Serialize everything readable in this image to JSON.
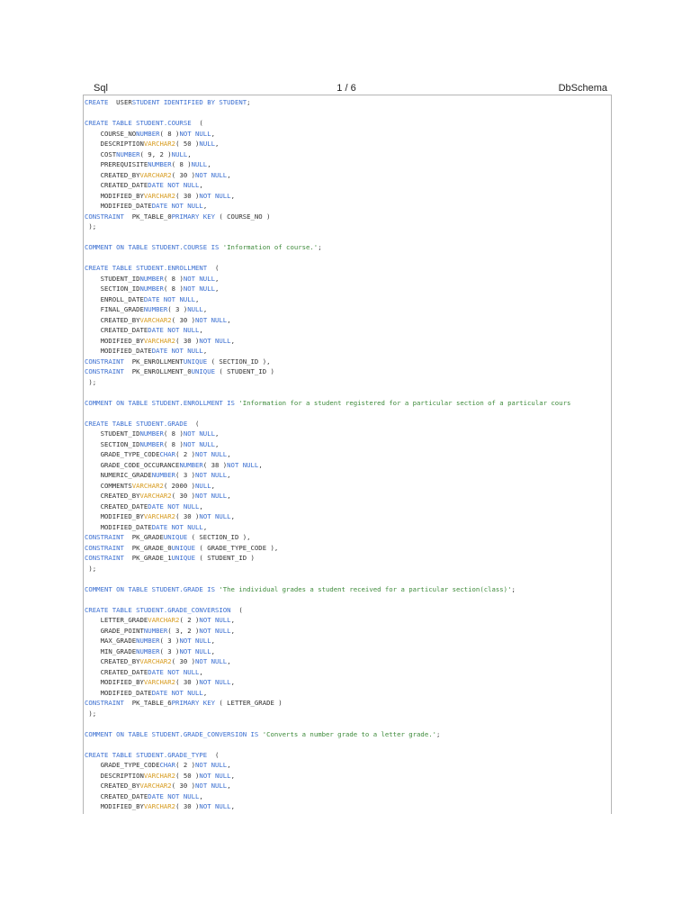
{
  "header": {
    "left": "Sql",
    "center": "1 / 6",
    "right": "DbSchema"
  },
  "colors": {
    "keyword": "#3b6fd1",
    "type": "#d79b1e",
    "string": "#3d8a3a",
    "plain": "#333333",
    "border": "#b5b5b5"
  },
  "code_lines": [
    [
      [
        "k",
        "CREATE  "
      ],
      [
        "p",
        "USER"
      ],
      [
        "k",
        "STUDENT IDENTIFIED BY STUDENT"
      ],
      [
        "p",
        ";"
      ]
    ],
    [],
    [
      [
        "k",
        "CREATE TABLE STUDENT.COURSE  "
      ],
      [
        "p",
        "("
      ]
    ],
    [
      [
        "p",
        "    COURSE_NO"
      ],
      [
        "k",
        "NUMBER"
      ],
      [
        "p",
        "( 8 )"
      ],
      [
        "k",
        "NOT NULL"
      ],
      [
        "p",
        ","
      ]
    ],
    [
      [
        "p",
        "    DESCRIPTION"
      ],
      [
        "t",
        "VARCHAR2"
      ],
      [
        "p",
        "( 50 )"
      ],
      [
        "k",
        "NULL"
      ],
      [
        "p",
        ","
      ]
    ],
    [
      [
        "p",
        "    COST"
      ],
      [
        "k",
        "NUMBER"
      ],
      [
        "p",
        "( 9, 2 )"
      ],
      [
        "k",
        "NULL"
      ],
      [
        "p",
        ","
      ]
    ],
    [
      [
        "p",
        "    PREREQUISITE"
      ],
      [
        "k",
        "NUMBER"
      ],
      [
        "p",
        "( 8 )"
      ],
      [
        "k",
        "NULL"
      ],
      [
        "p",
        ","
      ]
    ],
    [
      [
        "p",
        "    CREATED_BY"
      ],
      [
        "t",
        "VARCHAR2"
      ],
      [
        "p",
        "( 30 )"
      ],
      [
        "k",
        "NOT NULL"
      ],
      [
        "p",
        ","
      ]
    ],
    [
      [
        "p",
        "    CREATED_DATE"
      ],
      [
        "k",
        "DATE NOT NULL"
      ],
      [
        "p",
        ","
      ]
    ],
    [
      [
        "p",
        "    MODIFIED_BY"
      ],
      [
        "t",
        "VARCHAR2"
      ],
      [
        "p",
        "( 30 )"
      ],
      [
        "k",
        "NOT NULL"
      ],
      [
        "p",
        ","
      ]
    ],
    [
      [
        "p",
        "    MODIFIED_DATE"
      ],
      [
        "k",
        "DATE NOT NULL"
      ],
      [
        "p",
        ","
      ]
    ],
    [
      [
        "k",
        "CONSTRAINT  "
      ],
      [
        "p",
        "PK_TABLE_0"
      ],
      [
        "k",
        "PRIMARY KEY"
      ],
      [
        "p",
        " ( COURSE_NO )"
      ]
    ],
    [
      [
        "p",
        " );"
      ]
    ],
    [],
    [
      [
        "k",
        "COMMENT ON TABLE STUDENT.COURSE IS "
      ],
      [
        "s",
        "'Information of course.'"
      ],
      [
        "p",
        ";"
      ]
    ],
    [],
    [
      [
        "k",
        "CREATE TABLE STUDENT.ENROLLMENT  "
      ],
      [
        "p",
        "("
      ]
    ],
    [
      [
        "p",
        "    STUDENT_ID"
      ],
      [
        "k",
        "NUMBER"
      ],
      [
        "p",
        "( 8 )"
      ],
      [
        "k",
        "NOT NULL"
      ],
      [
        "p",
        ","
      ]
    ],
    [
      [
        "p",
        "    SECTION_ID"
      ],
      [
        "k",
        "NUMBER"
      ],
      [
        "p",
        "( 8 )"
      ],
      [
        "k",
        "NOT NULL"
      ],
      [
        "p",
        ","
      ]
    ],
    [
      [
        "p",
        "    ENROLL_DATE"
      ],
      [
        "k",
        "DATE NOT NULL"
      ],
      [
        "p",
        ","
      ]
    ],
    [
      [
        "p",
        "    FINAL_GRADE"
      ],
      [
        "k",
        "NUMBER"
      ],
      [
        "p",
        "( 3 )"
      ],
      [
        "k",
        "NULL"
      ],
      [
        "p",
        ","
      ]
    ],
    [
      [
        "p",
        "    CREATED_BY"
      ],
      [
        "t",
        "VARCHAR2"
      ],
      [
        "p",
        "( 30 )"
      ],
      [
        "k",
        "NOT NULL"
      ],
      [
        "p",
        ","
      ]
    ],
    [
      [
        "p",
        "    CREATED_DATE"
      ],
      [
        "k",
        "DATE NOT NULL"
      ],
      [
        "p",
        ","
      ]
    ],
    [
      [
        "p",
        "    MODIFIED_BY"
      ],
      [
        "t",
        "VARCHAR2"
      ],
      [
        "p",
        "( 30 )"
      ],
      [
        "k",
        "NOT NULL"
      ],
      [
        "p",
        ","
      ]
    ],
    [
      [
        "p",
        "    MODIFIED_DATE"
      ],
      [
        "k",
        "DATE NOT NULL"
      ],
      [
        "p",
        ","
      ]
    ],
    [
      [
        "k",
        "CONSTRAINT  "
      ],
      [
        "p",
        "PK_ENROLLMENT"
      ],
      [
        "k",
        "UNIQUE"
      ],
      [
        "p",
        " ( SECTION_ID ),"
      ]
    ],
    [
      [
        "k",
        "CONSTRAINT  "
      ],
      [
        "p",
        "PK_ENROLLMENT_0"
      ],
      [
        "k",
        "UNIQUE"
      ],
      [
        "p",
        " ( STUDENT_ID )"
      ]
    ],
    [
      [
        "p",
        " );"
      ]
    ],
    [],
    [
      [
        "k",
        "COMMENT ON TABLE STUDENT.ENROLLMENT IS "
      ],
      [
        "s",
        "'Information for a student registered for a particular section of a particular cours"
      ]
    ],
    [],
    [
      [
        "k",
        "CREATE TABLE STUDENT.GRADE  "
      ],
      [
        "p",
        "("
      ]
    ],
    [
      [
        "p",
        "    STUDENT_ID"
      ],
      [
        "k",
        "NUMBER"
      ],
      [
        "p",
        "( 8 )"
      ],
      [
        "k",
        "NOT NULL"
      ],
      [
        "p",
        ","
      ]
    ],
    [
      [
        "p",
        "    SECTION_ID"
      ],
      [
        "k",
        "NUMBER"
      ],
      [
        "p",
        "( 8 )"
      ],
      [
        "k",
        "NOT NULL"
      ],
      [
        "p",
        ","
      ]
    ],
    [
      [
        "p",
        "    GRADE_TYPE_CODE"
      ],
      [
        "k",
        "CHAR"
      ],
      [
        "p",
        "( 2 )"
      ],
      [
        "k",
        "NOT NULL"
      ],
      [
        "p",
        ","
      ]
    ],
    [
      [
        "p",
        "    GRADE_CODE_OCCURANCE"
      ],
      [
        "k",
        "NUMBER"
      ],
      [
        "p",
        "( 38 )"
      ],
      [
        "k",
        "NOT NULL"
      ],
      [
        "p",
        ","
      ]
    ],
    [
      [
        "p",
        "    NUMERIC_GRADE"
      ],
      [
        "k",
        "NUMBER"
      ],
      [
        "p",
        "( 3 )"
      ],
      [
        "k",
        "NOT NULL"
      ],
      [
        "p",
        ","
      ]
    ],
    [
      [
        "p",
        "    COMMENTS"
      ],
      [
        "t",
        "VARCHAR2"
      ],
      [
        "p",
        "( 2000 )"
      ],
      [
        "k",
        "NULL"
      ],
      [
        "p",
        ","
      ]
    ],
    [
      [
        "p",
        "    CREATED_BY"
      ],
      [
        "t",
        "VARCHAR2"
      ],
      [
        "p",
        "( 30 )"
      ],
      [
        "k",
        "NOT NULL"
      ],
      [
        "p",
        ","
      ]
    ],
    [
      [
        "p",
        "    CREATED_DATE"
      ],
      [
        "k",
        "DATE NOT NULL"
      ],
      [
        "p",
        ","
      ]
    ],
    [
      [
        "p",
        "    MODIFIED_BY"
      ],
      [
        "t",
        "VARCHAR2"
      ],
      [
        "p",
        "( 30 )"
      ],
      [
        "k",
        "NOT NULL"
      ],
      [
        "p",
        ","
      ]
    ],
    [
      [
        "p",
        "    MODIFIED_DATE"
      ],
      [
        "k",
        "DATE NOT NULL"
      ],
      [
        "p",
        ","
      ]
    ],
    [
      [
        "k",
        "CONSTRAINT  "
      ],
      [
        "p",
        "PK_GRADE"
      ],
      [
        "k",
        "UNIQUE"
      ],
      [
        "p",
        " ( SECTION_ID ),"
      ]
    ],
    [
      [
        "k",
        "CONSTRAINT  "
      ],
      [
        "p",
        "PK_GRADE_0"
      ],
      [
        "k",
        "UNIQUE"
      ],
      [
        "p",
        " ( GRADE_TYPE_CODE ),"
      ]
    ],
    [
      [
        "k",
        "CONSTRAINT  "
      ],
      [
        "p",
        "PK_GRADE_1"
      ],
      [
        "k",
        "UNIQUE"
      ],
      [
        "p",
        " ( STUDENT_ID )"
      ]
    ],
    [
      [
        "p",
        " );"
      ]
    ],
    [],
    [
      [
        "k",
        "COMMENT ON TABLE STUDENT.GRADE IS "
      ],
      [
        "s",
        "'The individual grades a student received for a particular section(class)'"
      ],
      [
        "p",
        ";"
      ]
    ],
    [],
    [
      [
        "k",
        "CREATE TABLE STUDENT.GRADE_CONVERSION  "
      ],
      [
        "p",
        "("
      ]
    ],
    [
      [
        "p",
        "    LETTER_GRADE"
      ],
      [
        "t",
        "VARCHAR2"
      ],
      [
        "p",
        "( 2 )"
      ],
      [
        "k",
        "NOT NULL"
      ],
      [
        "p",
        ","
      ]
    ],
    [
      [
        "p",
        "    GRADE_POINT"
      ],
      [
        "k",
        "NUMBER"
      ],
      [
        "p",
        "( 3, 2 )"
      ],
      [
        "k",
        "NOT NULL"
      ],
      [
        "p",
        ","
      ]
    ],
    [
      [
        "p",
        "    MAX_GRADE"
      ],
      [
        "k",
        "NUMBER"
      ],
      [
        "p",
        "( 3 )"
      ],
      [
        "k",
        "NOT NULL"
      ],
      [
        "p",
        ","
      ]
    ],
    [
      [
        "p",
        "    MIN_GRADE"
      ],
      [
        "k",
        "NUMBER"
      ],
      [
        "p",
        "( 3 )"
      ],
      [
        "k",
        "NOT NULL"
      ],
      [
        "p",
        ","
      ]
    ],
    [
      [
        "p",
        "    CREATED_BY"
      ],
      [
        "t",
        "VARCHAR2"
      ],
      [
        "p",
        "( 30 )"
      ],
      [
        "k",
        "NOT NULL"
      ],
      [
        "p",
        ","
      ]
    ],
    [
      [
        "p",
        "    CREATED_DATE"
      ],
      [
        "k",
        "DATE NOT NULL"
      ],
      [
        "p",
        ","
      ]
    ],
    [
      [
        "p",
        "    MODIFIED_BY"
      ],
      [
        "t",
        "VARCHAR2"
      ],
      [
        "p",
        "( 30 )"
      ],
      [
        "k",
        "NOT NULL"
      ],
      [
        "p",
        ","
      ]
    ],
    [
      [
        "p",
        "    MODIFIED_DATE"
      ],
      [
        "k",
        "DATE NOT NULL"
      ],
      [
        "p",
        ","
      ]
    ],
    [
      [
        "k",
        "CONSTRAINT  "
      ],
      [
        "p",
        "PK_TABLE_6"
      ],
      [
        "k",
        "PRIMARY KEY"
      ],
      [
        "p",
        " ( LETTER_GRADE )"
      ]
    ],
    [
      [
        "p",
        " );"
      ]
    ],
    [],
    [
      [
        "k",
        "COMMENT ON TABLE STUDENT.GRADE_CONVERSION IS "
      ],
      [
        "s",
        "'Converts a number grade to a letter grade.'"
      ],
      [
        "p",
        ";"
      ]
    ],
    [],
    [
      [
        "k",
        "CREATE TABLE STUDENT.GRADE_TYPE  "
      ],
      [
        "p",
        "("
      ]
    ],
    [
      [
        "p",
        "    GRADE_TYPE_CODE"
      ],
      [
        "k",
        "CHAR"
      ],
      [
        "p",
        "( 2 )"
      ],
      [
        "k",
        "NOT NULL"
      ],
      [
        "p",
        ","
      ]
    ],
    [
      [
        "p",
        "    DESCRIPTION"
      ],
      [
        "t",
        "VARCHAR2"
      ],
      [
        "p",
        "( 50 )"
      ],
      [
        "k",
        "NOT NULL"
      ],
      [
        "p",
        ","
      ]
    ],
    [
      [
        "p",
        "    CREATED_BY"
      ],
      [
        "t",
        "VARCHAR2"
      ],
      [
        "p",
        "( 30 )"
      ],
      [
        "k",
        "NOT NULL"
      ],
      [
        "p",
        ","
      ]
    ],
    [
      [
        "p",
        "    CREATED_DATE"
      ],
      [
        "k",
        "DATE NOT NULL"
      ],
      [
        "p",
        ","
      ]
    ],
    [
      [
        "p",
        "    MODIFIED_BY"
      ],
      [
        "t",
        "VARCHAR2"
      ],
      [
        "p",
        "( 30 )"
      ],
      [
        "k",
        "NOT NULL"
      ],
      [
        "p",
        ","
      ]
    ]
  ]
}
